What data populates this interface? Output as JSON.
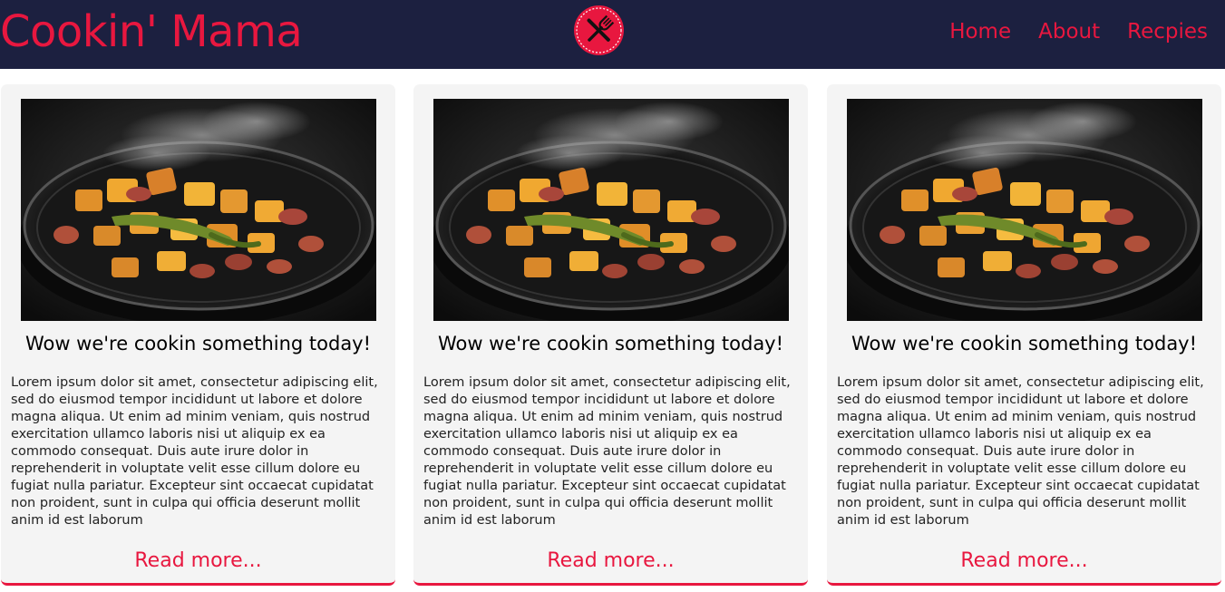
{
  "header": {
    "brand": "Cookin' Mama",
    "logo_icon": "fork-knife-icon",
    "nav": [
      {
        "label": "Home"
      },
      {
        "label": "About"
      },
      {
        "label": "Recpies"
      }
    ]
  },
  "colors": {
    "accent": "#e8173f",
    "navbar_bg": "#1c2040",
    "card_bg": "#f4f4f4"
  },
  "cards": [
    {
      "title": "Wow we're cookin something today!",
      "body": "Lorem ipsum dolor sit amet, consectetur adipiscing elit, sed do eiusmod tempor incididunt ut labore et dolore magna aliqua. Ut enim ad minim veniam, quis nostrud exercitation ullamco laboris nisi ut aliquip ex ea commodo consequat. Duis aute irure dolor in reprehenderit in voluptate velit esse cillum dolore eu fugiat nulla pariatur. Excepteur sint occaecat cupidatat non proident, sunt in culpa qui officia deserunt mollit anim id est laborum",
      "link": "Read more..."
    },
    {
      "title": "Wow we're cookin something today!",
      "body": "Lorem ipsum dolor sit amet, consectetur adipiscing elit, sed do eiusmod tempor incididunt ut labore et dolore magna aliqua. Ut enim ad minim veniam, quis nostrud exercitation ullamco laboris nisi ut aliquip ex ea commodo consequat. Duis aute irure dolor in reprehenderit in voluptate velit esse cillum dolore eu fugiat nulla pariatur. Excepteur sint occaecat cupidatat non proident, sunt in culpa qui officia deserunt mollit anim id est laborum",
      "link": "Read more..."
    },
    {
      "title": "Wow we're cookin something today!",
      "body": "Lorem ipsum dolor sit amet, consectetur adipiscing elit, sed do eiusmod tempor incididunt ut labore et dolore magna aliqua. Ut enim ad minim veniam, quis nostrud exercitation ullamco laboris nisi ut aliquip ex ea commodo consequat. Duis aute irure dolor in reprehenderit in voluptate velit esse cillum dolore eu fugiat nulla pariatur. Excepteur sint occaecat cupidatat non proident, sunt in culpa qui officia deserunt mollit anim id est laborum",
      "link": "Read more..."
    }
  ]
}
